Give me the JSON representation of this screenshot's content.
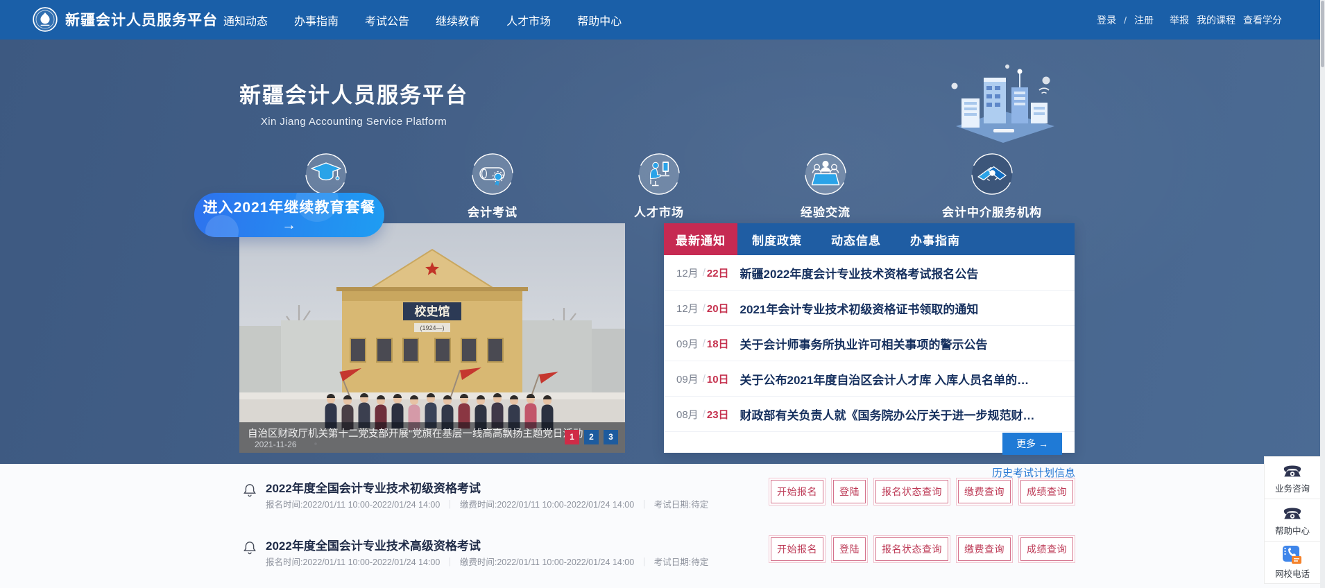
{
  "colors": {
    "nav_blue": "#1a5fa8",
    "hero_a": "#3d5981",
    "hero_b": "#4b6b94",
    "panel_blue": "#1f5da3",
    "tab_red": "#c62a52",
    "day_red": "#c5314e",
    "title_navy": "#16305e",
    "more_blue": "#1f7ad6",
    "cta_a": "#2e72ee",
    "cta_b": "#1e9df2",
    "pager_red": "#cf2b47",
    "pager_blue": "#1d5b9e",
    "btn_red": "#bd3a56",
    "link_blue": "#2a7ad4"
  },
  "topnav": {
    "brand": "新疆会计人员服务平台",
    "menu": [
      "通知动态",
      "办事指南",
      "考试公告",
      "继续教育",
      "人才市场",
      "帮助中心"
    ],
    "login": "登录",
    "slash": "/",
    "register": "注册",
    "report": "举报",
    "my_courses": "我的课程",
    "view_credits": "查看学分"
  },
  "hero": {
    "title": "新疆会计人员服务平台",
    "subtitle": "Xin Jiang Accounting Service Platform",
    "cta": "进入2021年继续教育套餐 →",
    "quick_links": [
      "会计考试",
      "人才市场",
      "经验交流",
      "会计中介服务机构"
    ]
  },
  "carousel": {
    "caption": "自治区财政厅机关第十二党支部开展“党旗在基层一线高高飘扬主题党日活动",
    "date": "2021-11-26",
    "pages": [
      "1",
      "2",
      "3"
    ],
    "photo_sign": "校史馆",
    "photo_sign_sub": "(1924—)"
  },
  "news": {
    "tabs": [
      "最新通知",
      "制度政策",
      "动态信息",
      "办事指南"
    ],
    "slash": "/",
    "items": [
      {
        "month": "12月",
        "day": "22日",
        "title": "新疆2022年度会计专业技术资格考试报名公告"
      },
      {
        "month": "12月",
        "day": "20日",
        "title": "2021年会计专业技术初级资格证书领取的通知"
      },
      {
        "month": "09月",
        "day": "18日",
        "title": "关于会计师事务所执业许可相关事项的警示公告"
      },
      {
        "month": "09月",
        "day": "10日",
        "title": "关于公布2021年度自治区会计人才库 入库人员名单的…"
      },
      {
        "month": "08月",
        "day": "23日",
        "title": "财政部有关负责人就《国务院办公厅关于进一步规范财…"
      }
    ],
    "more": "更多 →"
  },
  "exams": {
    "history_link": "历史考试计划信息",
    "separator": "｜",
    "button_labels": [
      "开始报名",
      "登陆",
      "报名状态查询",
      "缴费查询",
      "成绩查询"
    ],
    "items": [
      {
        "title": "2022年度全国会计专业技术初级资格考试",
        "reg_time": "报名时间:2022/01/11 10:00-2022/01/24 14:00",
        "pay_time": "缴费时间:2022/01/11 10:00-2022/01/24 14:00",
        "exam_date": "考试日期:待定"
      },
      {
        "title": "2022年度全国会计专业技术高级资格考试",
        "reg_time": "报名时间:2022/01/11 10:00-2022/01/24 14:00",
        "pay_time": "缴费时间:2022/01/11 10:00-2022/01/24 14:00",
        "exam_date": "考试日期:待定"
      }
    ]
  },
  "sidebar": {
    "items": [
      {
        "label": "业务咨询"
      },
      {
        "label": "帮助中心"
      },
      {
        "label": "网校电话"
      }
    ]
  }
}
